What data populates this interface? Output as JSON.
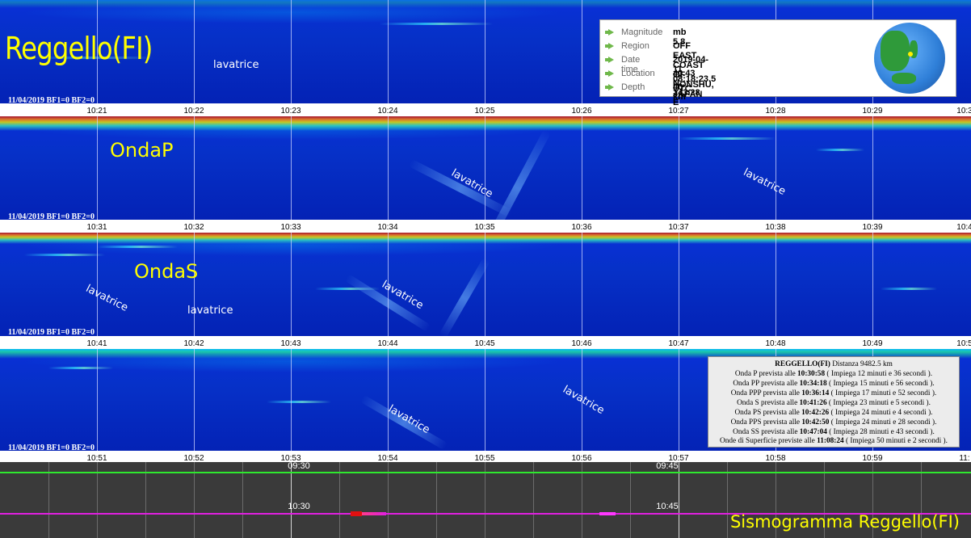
{
  "title": "Reggello(FI)",
  "station_stamp": "11/04/2019 BF1=0 BF2=0",
  "strips": [
    {
      "labels": [
        "10:21",
        "10:22",
        "10:23",
        "10:24",
        "10:25",
        "10:26",
        "10:27",
        "10:28",
        "10:29",
        "10:3"
      ]
    },
    {
      "labels": [
        "10:31",
        "10:32",
        "10:33",
        "10:34",
        "10:35",
        "10:36",
        "10:37",
        "10:38",
        "10:39",
        "10:4"
      ]
    },
    {
      "labels": [
        "10:41",
        "10:42",
        "10:43",
        "10:44",
        "10:45",
        "10:46",
        "10:47",
        "10:48",
        "10:49",
        "10:5"
      ]
    },
    {
      "labels": [
        "10:51",
        "10:52",
        "10:53",
        "10:54",
        "10:55",
        "10:56",
        "10:57",
        "10:58",
        "10:59",
        "11:"
      ]
    }
  ],
  "annotations": {
    "lavatrice": "lavatrice",
    "onda_p": "OndaP",
    "onda_s": "OndaS"
  },
  "earthquake": {
    "magnitude_label": "Magnitude",
    "magnitude": "mb 5.8",
    "region_label": "Region",
    "region": "OFF EAST COAST OF HONSHU, JAPAN",
    "datetime_label": "Date time",
    "datetime": "2019-04-11 08:18:23.5 UTC",
    "location_label": "Location",
    "location": "40.43 N ; 143.28 E",
    "depth_label": "Depth",
    "depth": "40 km"
  },
  "info": {
    "header_bold": "REGGELLO(FI)",
    "header_rest": " Distanza 9482.5 km",
    "rows": [
      {
        "pre": "Onda P prevista alle ",
        "time": "10:30:58",
        "post": " ( Impiega 12 minuti e 36 secondi )."
      },
      {
        "pre": "Onda PP prevista alle ",
        "time": "10:34:18",
        "post": " ( Impiega 15 minuti e 56 secondi )."
      },
      {
        "pre": "Onda PPP prevista alle ",
        "time": "10:36:14",
        "post": " ( Impiega 17 minuti e 52 secondi )."
      },
      {
        "pre": "Onda S prevista alle ",
        "time": "10:41:26",
        "post": " ( Impiega 23 minuti e 5 secondi )."
      },
      {
        "pre": "Onda PS prevista alle ",
        "time": "10:42:26",
        "post": " ( Impiega 24 minuti e 4 secondi )."
      },
      {
        "pre": "Onda PPS prevista alle ",
        "time": "10:42:50",
        "post": " ( Impiega 24 minuti e 28 secondi )."
      },
      {
        "pre": "Onda SS prevista alle ",
        "time": "10:47:04",
        "post": " ( Impiega 28 minuti e 43 secondi )."
      },
      {
        "pre": "Onde di Superficie previste alle ",
        "time": "11:08:24",
        "post": " ( Impiega 50 minuti e 2 secondi )."
      }
    ]
  },
  "bottom": {
    "utc_1": "09:30",
    "utc_2": "09:45",
    "local_1": "10:30",
    "local_2": "10:45",
    "caption": "Sismogramma Reggello(FI)"
  },
  "colors": {
    "accent": "#ffff00",
    "green": "#2ee82e",
    "magenta": "#e020e0"
  }
}
